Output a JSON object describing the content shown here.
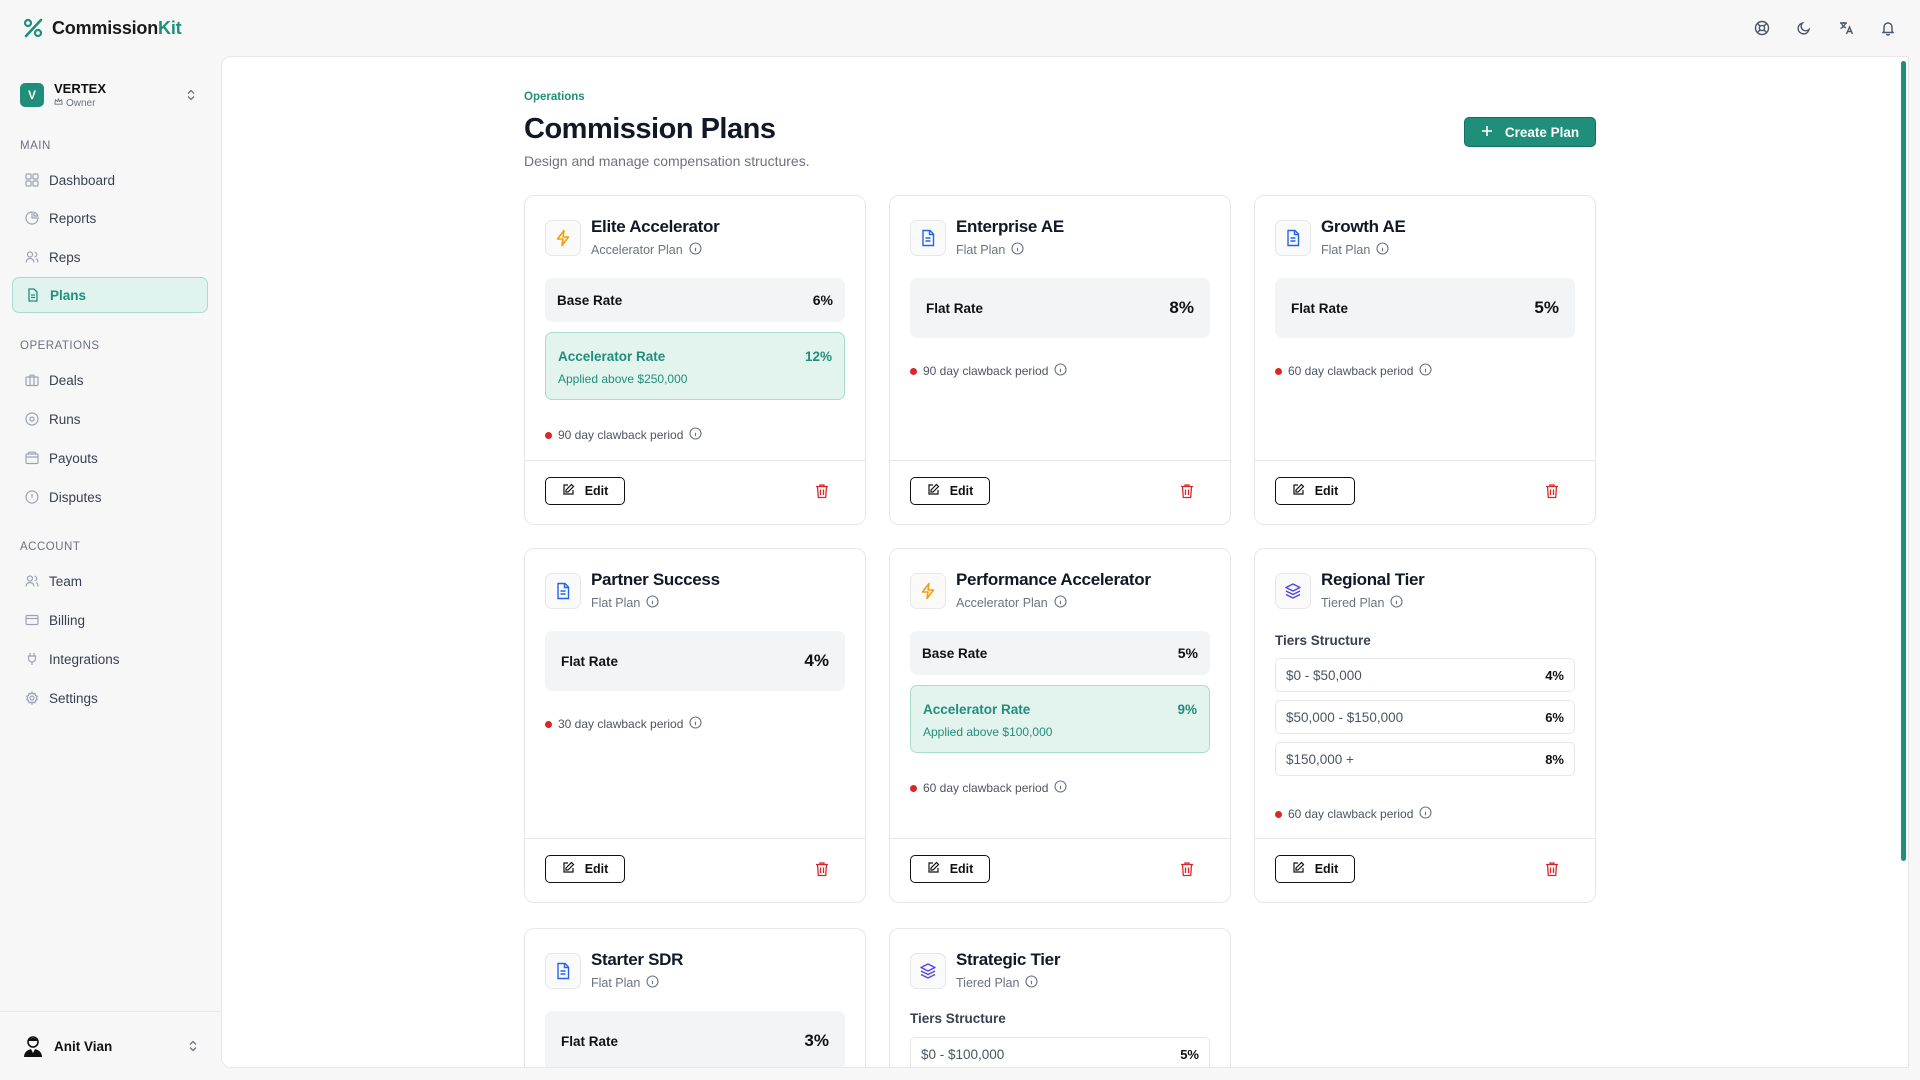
{
  "app": {
    "brand_main": "Commission",
    "brand_accent": "Kit"
  },
  "org": {
    "name": "VERTEX",
    "badge": "V",
    "role": "Owner"
  },
  "nav": {
    "sections": {
      "main": "MAIN",
      "operations": "OPERATIONS",
      "account": "ACCOUNT"
    },
    "items": [
      {
        "label": "Dashboard",
        "icon": "dashboard-icon"
      },
      {
        "label": "Reports",
        "icon": "pie-chart-icon"
      },
      {
        "label": "Reps",
        "icon": "users-icon"
      },
      {
        "label": "Plans",
        "icon": "document-icon",
        "active": true
      },
      {
        "label": "Deals",
        "icon": "briefcase-icon"
      },
      {
        "label": "Runs",
        "icon": "play-circle-icon"
      },
      {
        "label": "Payouts",
        "icon": "wallet-icon"
      },
      {
        "label": "Disputes",
        "icon": "alert-circle-icon"
      },
      {
        "label": "Team",
        "icon": "users-icon"
      },
      {
        "label": "Billing",
        "icon": "credit-card-icon"
      },
      {
        "label": "Integrations",
        "icon": "plug-icon"
      },
      {
        "label": "Settings",
        "icon": "gear-icon"
      }
    ]
  },
  "user": {
    "name": "Anit Vian"
  },
  "page": {
    "breadcrumb": "Operations",
    "title": "Commission Plans",
    "subtitle": "Design and manage compensation structures.",
    "create_label": "Create Plan"
  },
  "common": {
    "edit_label": "Edit",
    "tiers_label": "Tiers Structure"
  },
  "plans": [
    {
      "name": "Elite Accelerator",
      "type": "Accelerator Plan",
      "icon": "lightning-icon",
      "base_label": "Base Rate",
      "base_rate": "6%",
      "accel_label": "Accelerator Rate",
      "accel_rate": "12%",
      "accel_note": "Applied above $250,000",
      "clawback": "90 day clawback period"
    },
    {
      "name": "Enterprise AE",
      "type": "Flat Plan",
      "icon": "document-icon",
      "flat_label": "Flat Rate",
      "flat_rate": "8%",
      "clawback": "90 day clawback period"
    },
    {
      "name": "Growth AE",
      "type": "Flat Plan",
      "icon": "document-icon",
      "flat_label": "Flat Rate",
      "flat_rate": "5%",
      "clawback": "60 day clawback period"
    },
    {
      "name": "Partner Success",
      "type": "Flat Plan",
      "icon": "document-icon",
      "flat_label": "Flat Rate",
      "flat_rate": "4%",
      "clawback": "30 day clawback period"
    },
    {
      "name": "Performance Accelerator",
      "type": "Accelerator Plan",
      "icon": "lightning-icon",
      "base_label": "Base Rate",
      "base_rate": "5%",
      "accel_label": "Accelerator Rate",
      "accel_rate": "9%",
      "accel_note": "Applied above $100,000",
      "clawback": "60 day clawback period"
    },
    {
      "name": "Regional Tier",
      "type": "Tiered Plan",
      "icon": "layers-icon",
      "tiers": [
        {
          "range": "$0 - $50,000",
          "rate": "4%"
        },
        {
          "range": "$50,000 - $150,000",
          "rate": "6%"
        },
        {
          "range": "$150,000 +",
          "rate": "8%"
        }
      ],
      "clawback": "60 day clawback period"
    },
    {
      "name": "Starter SDR",
      "type": "Flat Plan",
      "icon": "document-icon",
      "flat_label": "Flat Rate",
      "flat_rate": "3%"
    },
    {
      "name": "Strategic Tier",
      "type": "Tiered Plan",
      "icon": "layers-icon",
      "tiers": [
        {
          "range": "$0 - $100,000",
          "rate": "5%"
        }
      ]
    }
  ],
  "colors": {
    "accent": "#1f8f7a",
    "danger": "#dc2626",
    "lightning": "#f59e0b",
    "doc": "#2563eb",
    "layers": "#4f46e5"
  }
}
